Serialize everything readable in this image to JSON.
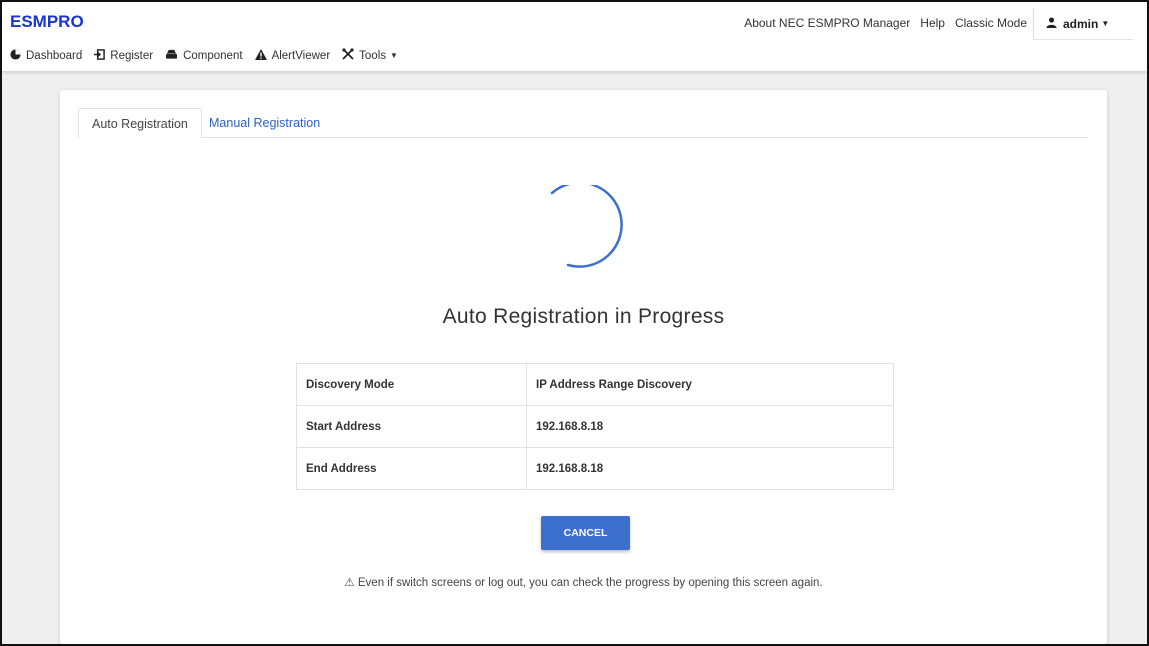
{
  "app": {
    "brand": "ESMPRO"
  },
  "header": {
    "links": [
      "About NEC ESMPRO Manager",
      "Help",
      "Classic Mode"
    ],
    "user": "admin"
  },
  "menu": [
    {
      "label": "Dashboard",
      "icon": "dashboard-icon"
    },
    {
      "label": "Register",
      "icon": "register-icon"
    },
    {
      "label": "Component",
      "icon": "component-icon"
    },
    {
      "label": "AlertViewer",
      "icon": "warning-icon"
    },
    {
      "label": "Tools",
      "icon": "tools-icon"
    }
  ],
  "tabs": {
    "active": "Auto Registration",
    "inactive": "Manual Registration"
  },
  "progress": {
    "title": "Auto Registration in Progress",
    "rows": [
      {
        "key": "Discovery Mode",
        "value": "IP Address Range Discovery"
      },
      {
        "key": "Start Address",
        "value": "192.168.8.18"
      },
      {
        "key": "End Address",
        "value": "192.168.8.18"
      }
    ],
    "cancel_label": "CANCEL",
    "note": "⚠ Even if switch screens or log out, you can check the progress by opening this screen again."
  },
  "colors": {
    "brand": "#1a35c9",
    "accent": "#3d6fce",
    "link": "#2a63c7"
  }
}
